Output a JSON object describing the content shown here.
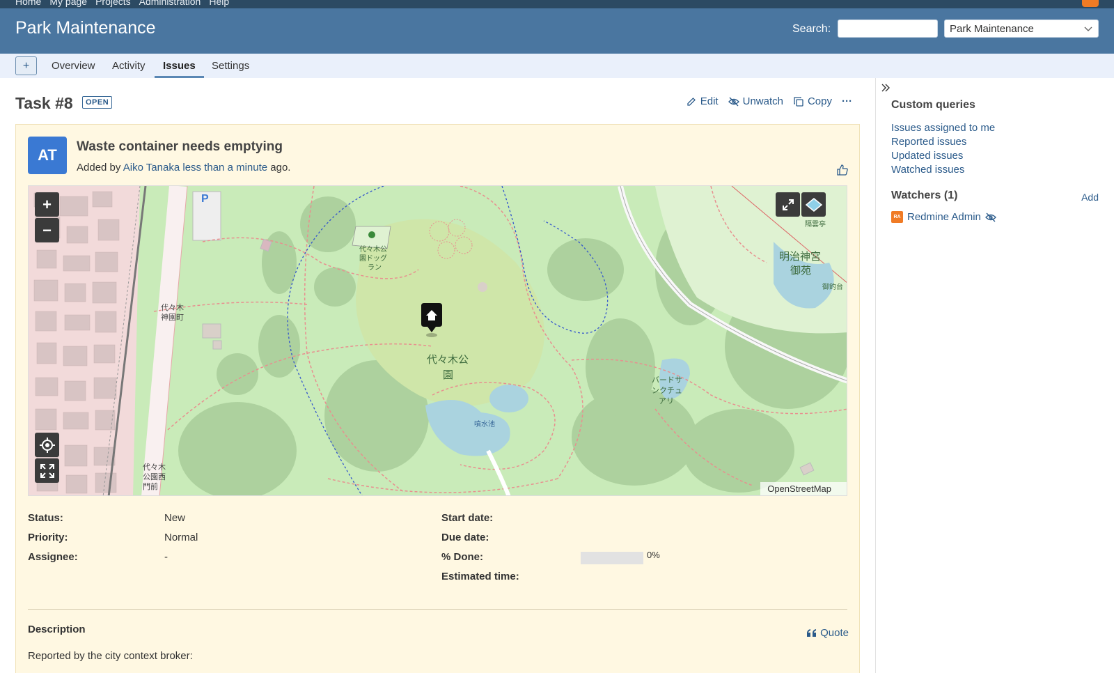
{
  "top_menu": {
    "items": [
      "Home",
      "My page",
      "Projects",
      "Administration",
      "Help"
    ]
  },
  "header": {
    "title": "Park Maintenance",
    "search_label": "Search:",
    "search_value": "",
    "project_select": "Park Maintenance"
  },
  "main_menu": {
    "new_label": "+",
    "tabs": [
      {
        "label": "Overview",
        "selected": false
      },
      {
        "label": "Activity",
        "selected": false
      },
      {
        "label": "Issues",
        "selected": true
      },
      {
        "label": "Settings",
        "selected": false
      }
    ]
  },
  "issue": {
    "title": "Task #8",
    "status_tag": "OPEN",
    "actions": {
      "edit": "Edit",
      "unwatch": "Unwatch",
      "copy": "Copy",
      "more": "···"
    },
    "avatar_initials": "AT",
    "subject": "Waste container needs emptying",
    "added_by_prefix": "Added by",
    "author": "Aiko Tanaka",
    "time": "less than a minute",
    "added_by_suffix": "ago.",
    "map": {
      "attribution": "OpenStreetMap",
      "zoom_in": "+",
      "zoom_out": "−",
      "labels": {
        "park": "代々木公",
        "park2": "園",
        "dogrun1": "代々木公",
        "dogrun2": "園ドッグ",
        "dogrun3": "ラン",
        "shrine1": "明治神宮",
        "shrine2": "御苑",
        "bird1": "バードサ",
        "bird2": "ンクチュ",
        "bird3": "アリ",
        "pond": "噴水池",
        "station1": "代々木",
        "station2": "神園町",
        "gate1": "代々木",
        "gate2": "公園西",
        "gate3": "門前",
        "tea": "隔雲亭",
        "fishing": "御釣台",
        "parking": "P"
      }
    },
    "attributes": {
      "left": [
        {
          "label": "Status:",
          "value": "New"
        },
        {
          "label": "Priority:",
          "value": "Normal"
        },
        {
          "label": "Assignee:",
          "value": "-"
        }
      ],
      "right": [
        {
          "label": "Start date:",
          "value": ""
        },
        {
          "label": "Due date:",
          "value": ""
        },
        {
          "label": "% Done:",
          "value": "0%",
          "progress": 0
        },
        {
          "label": "Estimated time:",
          "value": ""
        }
      ]
    },
    "description_label": "Description",
    "quote_label": "Quote",
    "description_text": "Reported by the city context broker:"
  },
  "sidebar": {
    "custom_queries_title": "Custom queries",
    "queries": [
      "Issues assigned to me",
      "Reported issues",
      "Updated issues",
      "Watched issues"
    ],
    "watchers_title": "Watchers (1)",
    "add_label": "Add",
    "watcher_initials": "RA",
    "watcher_name": "Redmine Admin"
  },
  "colors": {
    "header_bg": "#4a76a0",
    "top_menu_bg": "#2c4a63",
    "issue_bg": "#fff8e2",
    "avatar_bg": "#3a79d3",
    "link": "#2a5a8a",
    "map_green": "#c9ebb9"
  },
  "icons": [
    "edit-icon",
    "unwatch-icon",
    "copy-icon",
    "more-icon",
    "thumbs-up-icon",
    "quote-icon",
    "chevron-down-icon",
    "sidebar-toggle-icon",
    "unwatch-small-icon",
    "map-marker-icon",
    "locate-icon",
    "fullscreen-icon",
    "expand-icon",
    "layers-icon"
  ]
}
